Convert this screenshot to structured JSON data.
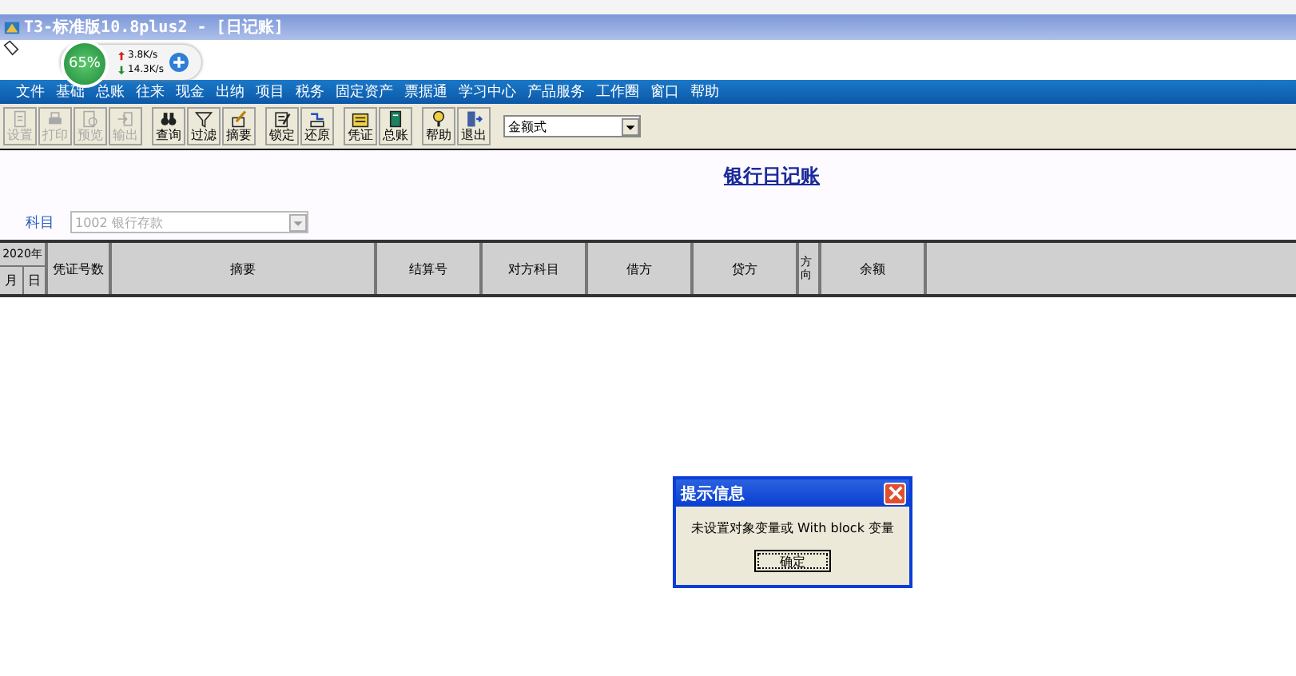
{
  "window": {
    "title": "T3-标准版10.8plus2 - [日记账]"
  },
  "net_widget": {
    "percent": "65%",
    "upload": "3.8K/s",
    "download": "14.3K/s"
  },
  "menu": [
    "文件",
    "基础",
    "总账",
    "往来",
    "现金",
    "出纳",
    "项目",
    "税务",
    "固定资产",
    "票据通",
    "学习中心",
    "产品服务",
    "工作圈",
    "窗口",
    "帮助"
  ],
  "toolbar": [
    {
      "label": "设置",
      "disabled": true
    },
    {
      "label": "打印",
      "disabled": true
    },
    {
      "label": "预览",
      "disabled": true
    },
    {
      "label": "输出",
      "disabled": true
    },
    {
      "label": "查询",
      "disabled": false
    },
    {
      "label": "过滤",
      "disabled": false
    },
    {
      "label": "摘要",
      "disabled": false
    },
    {
      "label": "锁定",
      "disabled": false
    },
    {
      "label": "还原",
      "disabled": false
    },
    {
      "label": "凭证",
      "disabled": false
    },
    {
      "label": "总账",
      "disabled": false
    },
    {
      "label": "帮助",
      "disabled": false
    },
    {
      "label": "退出",
      "disabled": false
    }
  ],
  "format_select": {
    "value": "金额式"
  },
  "report": {
    "title": "银行日记账",
    "subject_label": "科目",
    "subject_value": "1002 银行存款"
  },
  "table": {
    "year": "2020年",
    "month": "月",
    "day": "日",
    "columns": [
      "凭证号数",
      "摘要",
      "结算号",
      "对方科目",
      "借方",
      "贷方",
      "方向",
      "余额"
    ]
  },
  "dialog": {
    "title": "提示信息",
    "message": "未设置对象变量或 With block 变量",
    "button": "确定"
  }
}
